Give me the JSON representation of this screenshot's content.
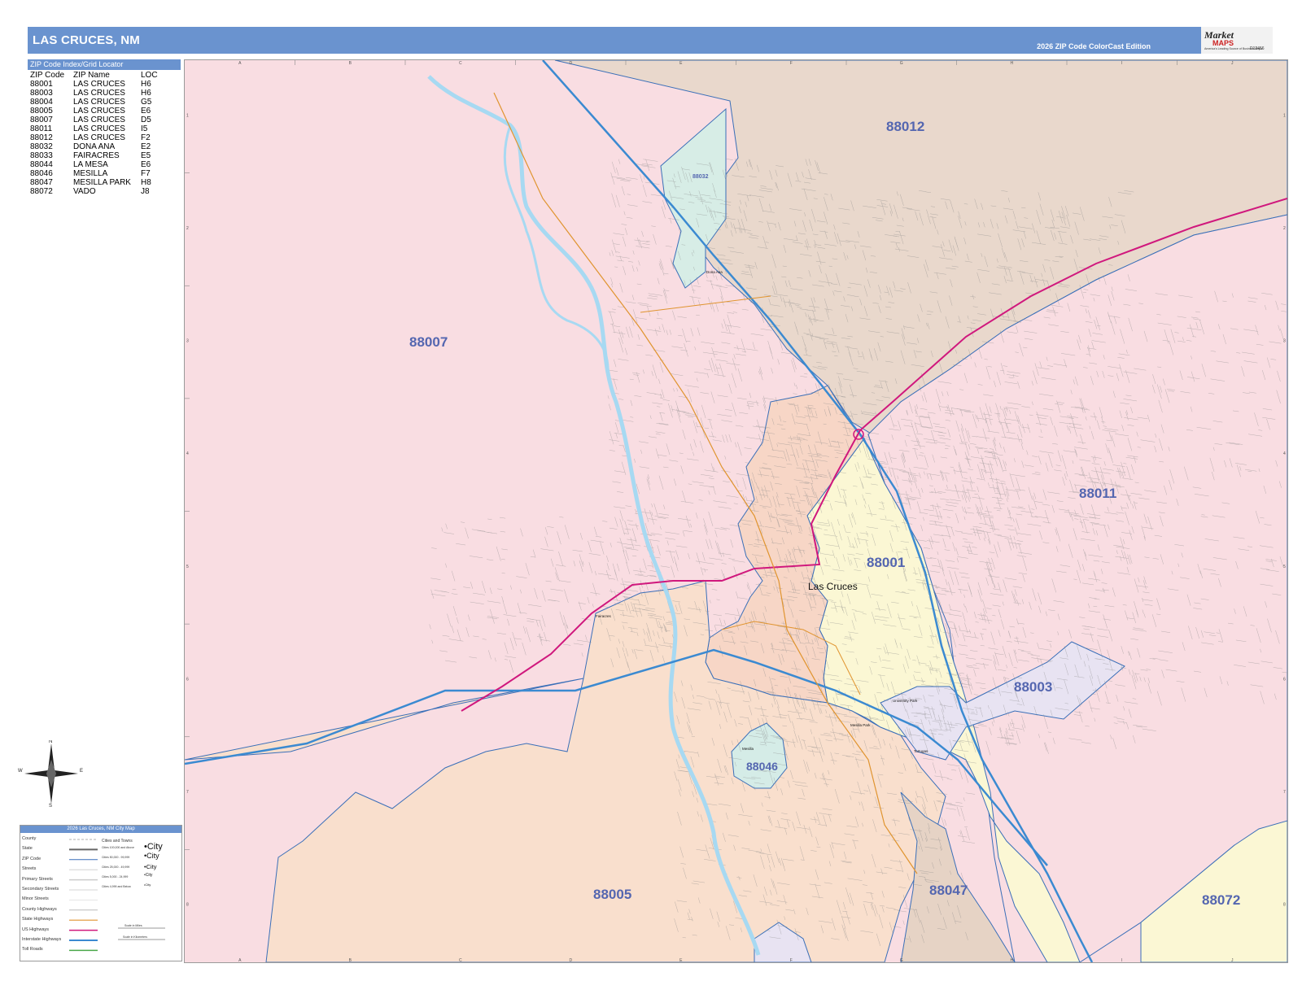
{
  "header": {
    "title": "LAS CRUCES, NM",
    "edition": "2026 ZIP Code ColorCast Edition"
  },
  "logo": {
    "brand_top": "Market",
    "brand_bottom": "MAPS",
    "tagline": "America's Leading Source of Business Maps",
    "code": "D12456"
  },
  "index": {
    "header": "ZIP Code Index/Grid Locator",
    "columns": [
      "ZIP Code",
      "ZIP Name",
      "LOC"
    ],
    "rows": [
      [
        "88001",
        "LAS CRUCES",
        "H6"
      ],
      [
        "88003",
        "LAS CRUCES",
        "H6"
      ],
      [
        "88004",
        "LAS CRUCES",
        "G5"
      ],
      [
        "88005",
        "LAS CRUCES",
        "E6"
      ],
      [
        "88007",
        "LAS CRUCES",
        "D5"
      ],
      [
        "88011",
        "LAS CRUCES",
        "I5"
      ],
      [
        "88012",
        "LAS CRUCES",
        "F2"
      ],
      [
        "88032",
        "DONA ANA",
        "E2"
      ],
      [
        "88033",
        "FAIRACRES",
        "E5"
      ],
      [
        "88044",
        "LA MESA",
        "E6"
      ],
      [
        "88046",
        "MESILLA",
        "F7"
      ],
      [
        "88047",
        "MESILLA PARK",
        "H8"
      ],
      [
        "88072",
        "VADO",
        "J8"
      ]
    ]
  },
  "map": {
    "grid_columns": [
      "A",
      "B",
      "C",
      "D",
      "E",
      "F",
      "G",
      "H",
      "I",
      "J"
    ],
    "grid_rows": [
      "1",
      "2",
      "3",
      "4",
      "5",
      "6",
      "7",
      "8"
    ],
    "zip_labels": {
      "z88012": "88012",
      "z88007": "88007",
      "z88011": "88011",
      "z88001": "88001",
      "z88003": "88003",
      "z88046": "88046",
      "z88005": "88005",
      "z88047": "88047",
      "z88072": "88072",
      "z88032": "88032"
    },
    "city_label": "Las Cruces",
    "places": {
      "dona_ana": "Dona Ana",
      "fairacres": "Fairacres",
      "mesilla": "Mesilla",
      "mesilla_park": "Mesilla Park",
      "university_park": "University Park",
      "tortugas": "Tortugas"
    },
    "colors": {
      "88007": "#f9dde2",
      "88011": "#f9dde2",
      "88012": "#e9d8cc",
      "88001": "#fbf7d4",
      "88003": "#e8e3f2",
      "88005": "#f9dfcd",
      "88046": "#d5ece7",
      "88047": "#e9d8cc",
      "88072": "#fbf7d4",
      "88032": "#d7ede6",
      "river": "#a7d9f2",
      "zip_border": "#3a6fb8",
      "interstate": "#3b8ad1",
      "us_highway": "#d0187d",
      "state_highway": "#e0942f"
    }
  },
  "compass": {
    "n": "N",
    "s": "S",
    "e": "E",
    "w": "W"
  },
  "legend": {
    "title": "2026 Las Cruces, NM City Map",
    "rows": [
      "County",
      "State",
      "ZIP Code",
      "Streets",
      "Primary Streets",
      "Secondary Streets",
      "Minor Streets",
      "County Highways",
      "State Highways",
      "US Highways",
      "Interstate Highways",
      "Toll Roads"
    ],
    "cities_header": "Cities and Towns",
    "city_tiers": [
      "Cities 100,000 and Above",
      "Cities 50,000 - 99,999",
      "Cities 25,000 - 49,999",
      "Cities 5,000 - 24,999",
      "Cities 4,999 and Below"
    ],
    "city_samples": [
      "City",
      "City",
      "City",
      "City",
      "City"
    ],
    "scale_miles": "Scale in Miles",
    "scale_km": "Scale in Kilometers"
  }
}
